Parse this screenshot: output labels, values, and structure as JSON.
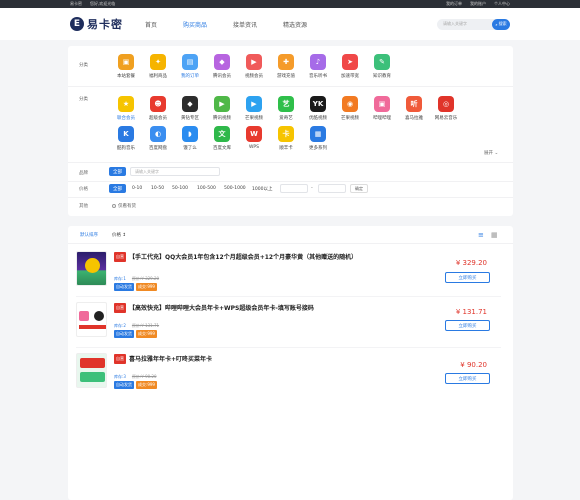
{
  "topbar": {
    "left": [
      "易卡密",
      "您好,欢迎光临"
    ],
    "right": [
      "我的订单",
      "我的账户",
      "个人中心"
    ]
  },
  "header": {
    "logo_letter": "E",
    "logo_text": "易卡密",
    "nav": [
      "首页",
      "购买商品",
      "接单资讯",
      "精选资源"
    ],
    "search_placeholder": "请输入关键字",
    "search_button": "搜索"
  },
  "filters": {
    "label_category": "分类",
    "label_subcategory": "分类",
    "label_brand": "品牌",
    "label_price": "价格",
    "label_other": "其他",
    "categories": [
      {
        "label": "本站套餐",
        "color": "#f0a020",
        "glyph": "▣"
      },
      {
        "label": "福利商品",
        "color": "#f6b400",
        "glyph": "✦"
      },
      {
        "label": "我的订单",
        "color": "#4da3f5",
        "glyph": "▤"
      },
      {
        "label": "腾讯会员",
        "color": "#b764e0",
        "glyph": "◆"
      },
      {
        "label": "视频会员",
        "color": "#f05a5a",
        "glyph": "▶"
      },
      {
        "label": "游戏充值",
        "color": "#f59b2a",
        "glyph": "✚"
      },
      {
        "label": "音乐听书",
        "color": "#a66be8",
        "glyph": "♪"
      },
      {
        "label": "加速带宽",
        "color": "#f04848",
        "glyph": "➤"
      },
      {
        "label": "知识教育",
        "color": "#3cc07a",
        "glyph": "✎"
      }
    ],
    "subcategories_row1": [
      {
        "label": "联合会员",
        "color": "#f6c400",
        "glyph": "★"
      },
      {
        "label": "超级会员",
        "color": "#e83a2e",
        "glyph": "☻"
      },
      {
        "label": "黄钻专区",
        "color": "#2d2d2d",
        "glyph": "◆"
      },
      {
        "label": "腾讯视频",
        "color": "#4fb848",
        "glyph": "▶"
      },
      {
        "label": "芒果视频",
        "color": "#2da2f0",
        "glyph": "▶"
      },
      {
        "label": "爱奇艺",
        "color": "#2fbf4a",
        "glyph": "艺"
      },
      {
        "label": "优酷视频",
        "color": "#1a1a1a",
        "glyph": "YK"
      },
      {
        "label": "芒果视频",
        "color": "#f27a22",
        "glyph": "◉"
      },
      {
        "label": "哔哩哔哩",
        "color": "#f06a9a",
        "glyph": "▣"
      },
      {
        "label": "喜马拉雅",
        "color": "#f05a3a",
        "glyph": "听"
      },
      {
        "label": "网易云音乐",
        "color": "#e0342a",
        "glyph": "◎"
      }
    ],
    "subcategories_row2": [
      {
        "label": "酷狗音乐",
        "color": "#2a7ae2",
        "glyph": "K"
      },
      {
        "label": "百度网盘",
        "color": "#3a8ef0",
        "glyph": "◐"
      },
      {
        "label": "饿了么",
        "color": "#2a8cf0",
        "glyph": "◗"
      },
      {
        "label": "百度文库",
        "color": "#2fb84a",
        "glyph": "文"
      },
      {
        "label": "WPS",
        "color": "#e83a2e",
        "glyph": "W"
      },
      {
        "label": "顺丰卡",
        "color": "#f6c400",
        "glyph": "卡"
      },
      {
        "label": "更多系列",
        "color": "#2a7ae2",
        "glyph": "▦"
      }
    ],
    "more_label": "展开",
    "brand_all": "全部",
    "brand_placeholder": "请输入关键字",
    "price_options": [
      "全部",
      "0-10",
      "10-50",
      "50-100",
      "100-500",
      "500-1000",
      "1000以上"
    ],
    "price_dash": "-",
    "price_confirm": "确定",
    "other_option": "仅看有货"
  },
  "list": {
    "sort_tabs": [
      "默认排序",
      "价格 ↕"
    ],
    "items": [
      {
        "tag": "自营",
        "title": "【手工代充】QQ大会员1年包含12个月超级会员+12个月豪华黄（其他赠送的随机）",
        "price": "¥ 329.20",
        "buy": "立即购买",
        "meta1": "库存:1",
        "meta2": "原价:¥ 329.20",
        "meta3": "0",
        "badge1": "自动发货",
        "badge2": "成交:999"
      },
      {
        "tag": "自营",
        "title": "【高效快充】哔哩哔哩大会员年卡+WPS超级会员年卡-填写账号接码",
        "price": "¥ 131.71",
        "buy": "立即购买",
        "meta1": "库存:2",
        "meta2": "原价:¥ 131.71",
        "meta3": "",
        "badge1": "自动发货",
        "badge2": "成交:999"
      },
      {
        "tag": "自营",
        "title": "喜马拉雅年年卡+叮咚买菜年卡",
        "price": "¥ 90.20",
        "buy": "立即购买",
        "meta1": "库存:3",
        "meta2": "原价:¥ 90.20",
        "meta3": "",
        "badge1": "自动发货",
        "badge2": "成交:999"
      }
    ]
  }
}
